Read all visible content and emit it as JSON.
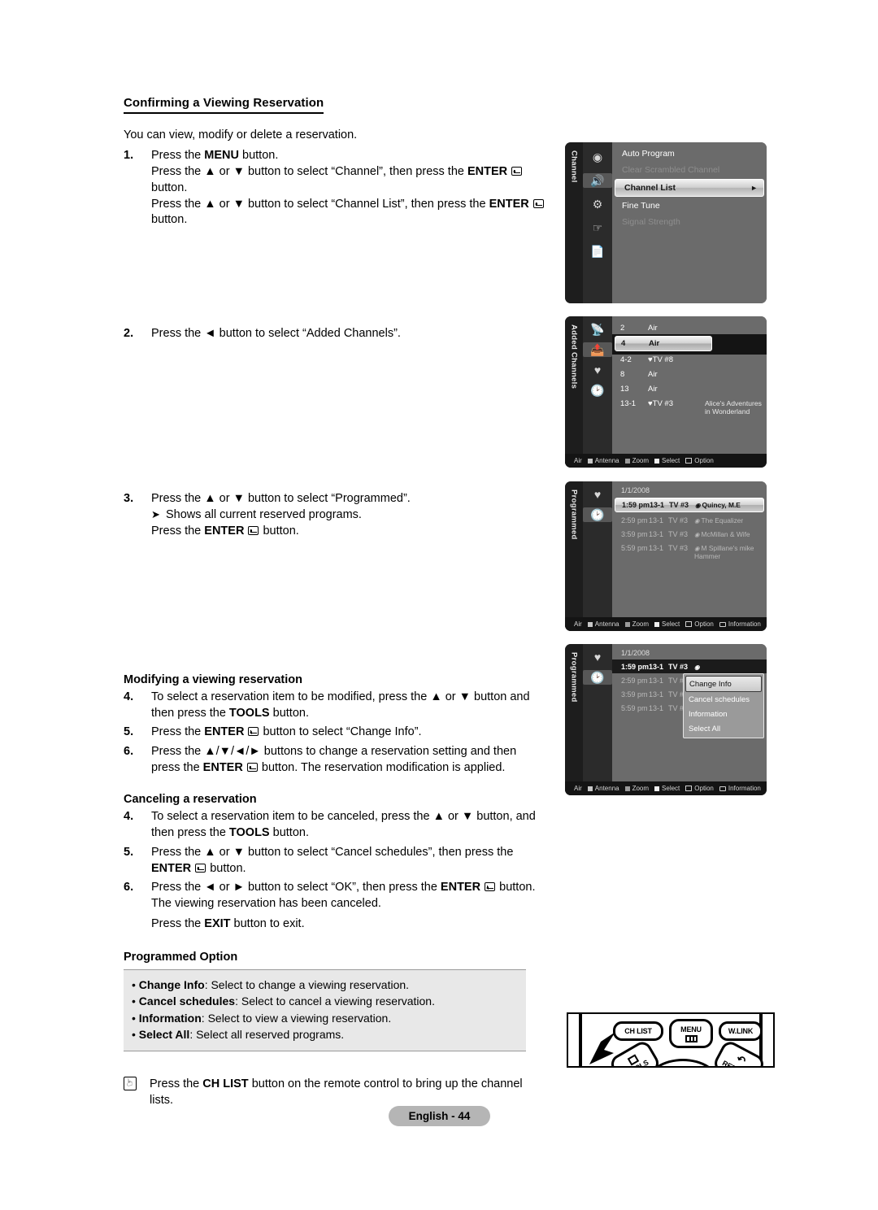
{
  "document": {
    "section_title": "Confirming a Viewing Reservation",
    "intro": "You can view, modify or delete a reservation.",
    "steps": [
      {
        "num": "1.",
        "lines": [
          "Press the MENU button.",
          "Press the ▲ or ▼ button to select “Channel”, then press the ENTER  button.",
          "Press the ▲ or ▼ button to select “Channel List”, then press the ENTER  button."
        ]
      },
      {
        "num": "2.",
        "lines": [
          "Press the ◄ button to select “Added Channels”."
        ]
      },
      {
        "num": "3.",
        "lines": [
          "Press the ▲ or ▼ button to select “Programmed”.",
          "Shows all current reserved programs.",
          "Press the ENTER  button."
        ]
      }
    ],
    "step1_line1_a": "Press the ",
    "step1_line1_b": "MENU",
    "step1_line1_c": " button.",
    "step1_line2_a": "Press the ▲ or ▼ button to select “Channel”, then press the ",
    "step1_line2_b": "ENTER",
    "step1_line2_c": "button.",
    "step1_line3_a": "Press the ▲ or ▼ button to select “Channel List”, then press the ",
    "step1_line3_b": "ENTER",
    "step1_line3_c": "button.",
    "step2_text": "Press the ◄ button to select “Added Channels”.",
    "step3_line1": "Press the ▲ or ▼ button to select “Programmed”.",
    "step3_note": "Shows all current reserved programs.",
    "step3_line3_a": "Press the ",
    "step3_line3_b": "ENTER",
    "step3_line3_c": " button.",
    "modify_heading": "Modifying a viewing reservation",
    "modify_steps": [
      {
        "num": "4.",
        "a": "To select a reservation item to be modified, press the ▲ or ▼ button and then press the ",
        "bold": "TOOLS",
        "c": " button."
      },
      {
        "num": "5.",
        "a": "Press the ",
        "bold": "ENTER",
        "c": " button to select “Change Info”."
      },
      {
        "num": "6.",
        "a": "Press the ▲/▼/◄/► buttons to change a reservation setting and then press the ",
        "bold": "ENTER",
        "c": " button. The reservation modification is applied."
      }
    ],
    "cancel_heading": "Canceling a reservation",
    "cancel_steps": [
      {
        "num": "4.",
        "a": "To select a reservation item to be canceled, press the ▲ or ▼ button, and then press the ",
        "bold": "TOOLS",
        "c": " button."
      },
      {
        "num": "5.",
        "a": "Press the ▲ or ▼ button to select “Cancel schedules”, then press the ",
        "bold": "ENTER",
        "c": " button."
      },
      {
        "num": "6.",
        "a": "Press the ◄ or ► button to select “OK”, then press the ",
        "bold": "ENTER",
        "c": " button. The viewing reservation has been canceled."
      }
    ],
    "exit_line_a": "Press the ",
    "exit_line_b": "EXIT",
    "exit_line_c": " button to exit.",
    "programmed_option_title": "Programmed Option",
    "programmed_options": [
      {
        "term": "Change Info",
        "desc": ": Select to change a viewing reservation."
      },
      {
        "term": "Cancel schedules",
        "desc": ": Select to cancel a viewing reservation."
      },
      {
        "term": "Information",
        "desc": ": Select to view a viewing reservation."
      },
      {
        "term": "Select All",
        "desc": ": Select all reserved programs."
      }
    ],
    "note_a": "Press the ",
    "note_b": "CH LIST",
    "note_c": " button on the remote control to bring up the channel lists.",
    "footer": "English - 44"
  },
  "tv_shot_channel_menu": {
    "tab_label": "Channel",
    "icons": [
      "picture-icon",
      "sound-icon",
      "setup-icon",
      "input-icon",
      "support-icon"
    ],
    "selected_icon_index": 1,
    "rows": [
      {
        "label": "Auto Program",
        "state": "normal"
      },
      {
        "label": "Clear Scrambled Channel",
        "state": "dim"
      },
      {
        "label": "Channel List",
        "state": "highlight",
        "caret": "►"
      },
      {
        "label": "Fine Tune",
        "state": "normal"
      },
      {
        "label": "Signal Strength",
        "state": "dim"
      }
    ]
  },
  "tv_shot_added_channels": {
    "tab_label": "Added Channels",
    "icons": [
      "antenna-all-icon",
      "added-channels-icon",
      "favorite-icon",
      "programmed-icon"
    ],
    "selected_icon_index": 1,
    "rows": [
      {
        "num": "2",
        "name": "Air",
        "title": "",
        "state": "normal"
      },
      {
        "num": "4",
        "name": "Air",
        "title": "",
        "state": "highlight"
      },
      {
        "num": "4-2",
        "name": "♥TV #8",
        "title": "",
        "state": "normal"
      },
      {
        "num": "8",
        "name": "Air",
        "title": "",
        "state": "normal"
      },
      {
        "num": "13",
        "name": "Air",
        "title": "",
        "state": "normal"
      },
      {
        "num": "13-1",
        "name": "♥TV #3",
        "title": "Alice's Adventures in Wonderland",
        "state": "normal"
      }
    ],
    "status_bar": {
      "source": "Air",
      "items": [
        {
          "label": "Antenna",
          "swatch": "red"
        },
        {
          "label": "Zoom",
          "swatch": "green"
        },
        {
          "label": "Select",
          "swatch": "yellow"
        },
        {
          "label": "Option",
          "swatch": "opt"
        }
      ]
    }
  },
  "tv_shot_programmed": {
    "tab_label": "Programmed",
    "icons": [
      "favorite-icon",
      "programmed-icon"
    ],
    "selected_icon_index": 1,
    "date": "1/1/2008",
    "rows": [
      {
        "time": "1:59 pm",
        "ch": "13-1",
        "src": "TV #3",
        "prog": "Quincy, M.E",
        "state": "highlight"
      },
      {
        "time": "2:59 pm",
        "ch": "13-1",
        "src": "TV #3",
        "prog": "The Equalizer",
        "state": "normal"
      },
      {
        "time": "3:59 pm",
        "ch": "13-1",
        "src": "TV #3",
        "prog": "McMillan & Wife",
        "state": "normal"
      },
      {
        "time": "5:59 pm",
        "ch": "13-1",
        "src": "TV #3",
        "prog": "M Spillane's mike Hammer",
        "state": "normal"
      }
    ],
    "status_bar": {
      "source": "Air",
      "items": [
        {
          "label": "Antenna",
          "swatch": "red"
        },
        {
          "label": "Zoom",
          "swatch": "green"
        },
        {
          "label": "Select",
          "swatch": "yellow"
        },
        {
          "label": "Option",
          "swatch": "opt"
        },
        {
          "label": "Information",
          "swatch": "info"
        }
      ]
    }
  },
  "tv_shot_programmed_options": {
    "tab_label": "Programmed",
    "icons": [
      "favorite-icon",
      "programmed-icon"
    ],
    "selected_icon_index": 1,
    "date": "1/1/2008",
    "rows": [
      {
        "time": "1:59 pm",
        "ch": "13-1",
        "src": "TV #3",
        "prog": "",
        "state": "highlight-dark"
      },
      {
        "time": "2:59 pm",
        "ch": "13-1",
        "src": "TV #3",
        "prog": "",
        "state": "normal"
      },
      {
        "time": "3:59 pm",
        "ch": "13-1",
        "src": "TV #3",
        "prog": "",
        "state": "normal"
      },
      {
        "time": "5:59 pm",
        "ch": "13-1",
        "src": "TV #3",
        "prog": "",
        "state": "normal"
      }
    ],
    "popup": {
      "items": [
        {
          "label": "Change Info",
          "selected": true
        },
        {
          "label": "Cancel schedules",
          "selected": false
        },
        {
          "label": "Information",
          "selected": false
        },
        {
          "label": "Select All",
          "selected": false
        }
      ]
    },
    "status_bar": {
      "source": "Air",
      "items": [
        {
          "label": "Antenna",
          "swatch": "red"
        },
        {
          "label": "Zoom",
          "swatch": "green"
        },
        {
          "label": "Select",
          "swatch": "yellow"
        },
        {
          "label": "Option",
          "swatch": "opt"
        },
        {
          "label": "Information",
          "swatch": "info"
        }
      ]
    }
  },
  "remote": {
    "buttons": [
      {
        "label": "CH LIST",
        "name": "ch-list-button"
      },
      {
        "label": "MENU",
        "name": "menu-button"
      },
      {
        "label": "W.LINK",
        "name": "wlink-button"
      },
      {
        "label": "TOOLS",
        "name": "tools-button"
      },
      {
        "label": "RETURN",
        "name": "return-button"
      }
    ]
  },
  "colors": {
    "page_background": "#ffffff",
    "text": "#000000",
    "option_box_background": "#e8e8e8",
    "footer_background": "#b5b5b5",
    "tv_menu_background": "#6b6b6b",
    "tv_sidebar": "#2b2b2b",
    "tv_tab": "#1d1d1d",
    "tv_status_bar": "#141414",
    "tv_highlight": "#d2d2d2"
  }
}
